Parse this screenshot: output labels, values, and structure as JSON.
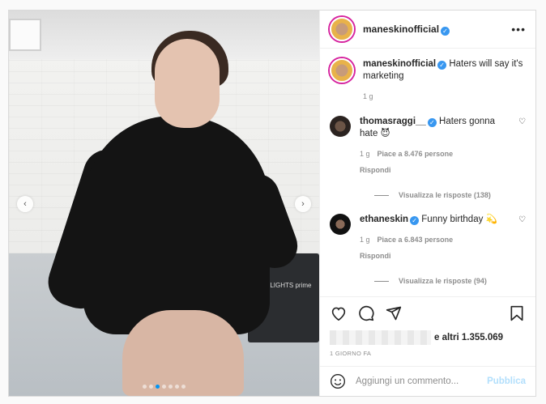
{
  "post": {
    "username": "maneskinofficial",
    "more_icon": "•••",
    "caption": "Haters will say it's marketing",
    "caption_time": "1 g",
    "photo_text": "PROLIGHTS prime"
  },
  "comments": [
    {
      "username": "thomasraggi__",
      "text": "Haters gonna hate 😈",
      "time": "1 g",
      "likes": "Piace a 8.476 persone",
      "reply": "Rispondi",
      "view_replies": "Visualizza le risposte (138)"
    },
    {
      "username": "ethaneskin",
      "text": "Funny birthday 💫",
      "time": "1 g",
      "likes": "Piace a 6.843 persone",
      "reply": "Rispondi",
      "view_replies": "Visualizza le risposte (94)"
    }
  ],
  "likes": {
    "others": "e altri 1.355.069"
  },
  "date": "1 GIORNO FA",
  "add_comment": {
    "placeholder": "Aggiungi un commento...",
    "publish": "Pubblica"
  },
  "carousel": {
    "prev_icon": "‹",
    "next_icon": "›",
    "dots": 7,
    "active_dot": 2
  },
  "colors": {
    "accent": "#0095f6",
    "verified": "#3897f0",
    "publish_disabled": "#b2dffc"
  }
}
